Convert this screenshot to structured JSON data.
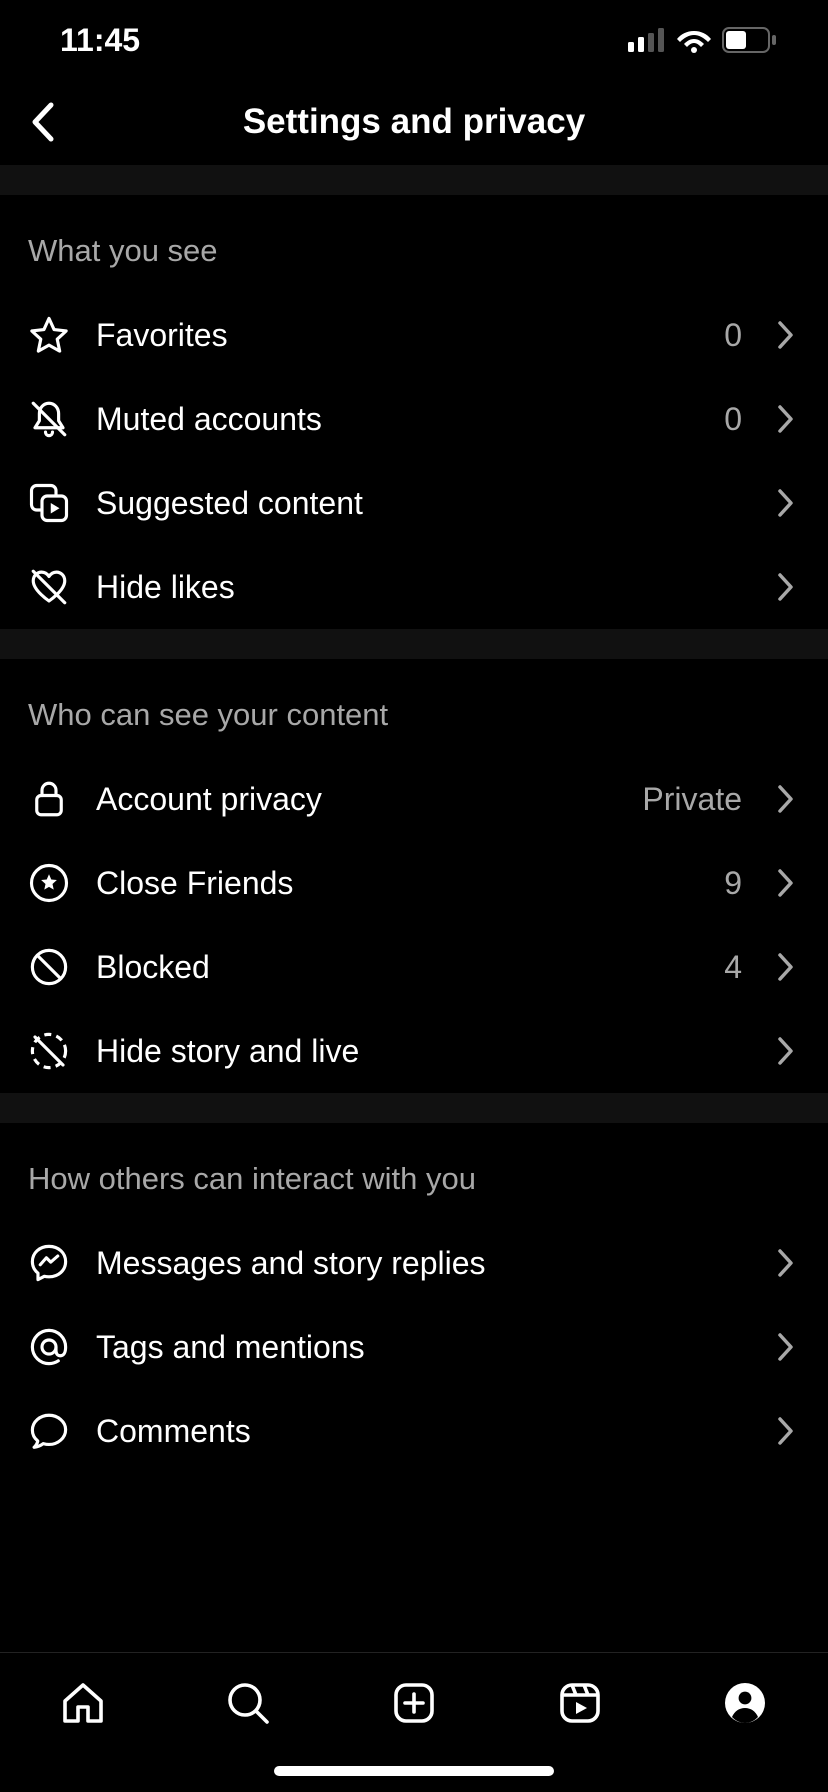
{
  "status": {
    "time": "11:45"
  },
  "header": {
    "title": "Settings and privacy"
  },
  "sections": [
    {
      "title": "What you see",
      "items": [
        {
          "icon": "star-icon",
          "label": "Favorites",
          "value": "0"
        },
        {
          "icon": "muted-bell-icon",
          "label": "Muted accounts",
          "value": "0"
        },
        {
          "icon": "suggested-icon",
          "label": "Suggested content",
          "value": ""
        },
        {
          "icon": "hide-likes-icon",
          "label": "Hide likes",
          "value": ""
        }
      ]
    },
    {
      "title": "Who can see your content",
      "items": [
        {
          "icon": "lock-icon",
          "label": "Account privacy",
          "value": "Private"
        },
        {
          "icon": "close-friends-icon",
          "label": "Close Friends",
          "value": "9"
        },
        {
          "icon": "blocked-icon",
          "label": "Blocked",
          "value": "4"
        },
        {
          "icon": "hide-story-icon",
          "label": "Hide story and live",
          "value": ""
        }
      ]
    },
    {
      "title": "How others can interact with you",
      "items": [
        {
          "icon": "messenger-icon",
          "label": "Messages and story replies",
          "value": ""
        },
        {
          "icon": "at-icon",
          "label": "Tags and mentions",
          "value": ""
        },
        {
          "icon": "comments-icon",
          "label": "Comments",
          "value": ""
        }
      ]
    }
  ]
}
